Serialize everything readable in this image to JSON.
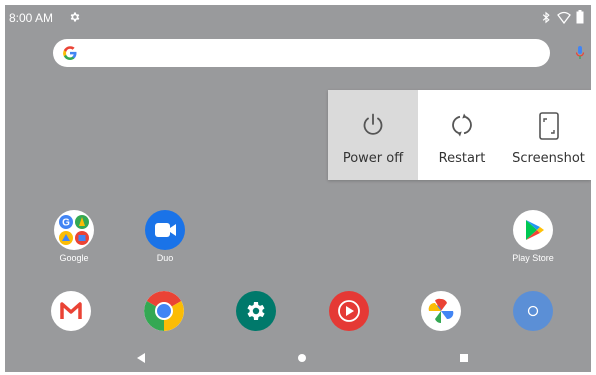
{
  "status_bar": {
    "time": "8:00 AM",
    "icons": [
      "settings-gear-icon",
      "bluetooth-icon",
      "wifi-icon",
      "battery-icon"
    ]
  },
  "search_bar": {
    "logo": "google-g-icon",
    "mic": "mic-icon"
  },
  "power_menu": {
    "items": [
      {
        "label": "Power off",
        "icon": "power-icon",
        "highlighted": true
      },
      {
        "label": "Restart",
        "icon": "restart-icon"
      },
      {
        "label": "Screenshot",
        "icon": "screenshot-icon"
      }
    ]
  },
  "home_apps": [
    {
      "label": "Google",
      "icon": "google-folder-icon"
    },
    {
      "label": "Duo",
      "icon": "duo-icon"
    },
    {
      "label": "Play Store",
      "icon": "play-store-icon"
    }
  ],
  "dock": [
    {
      "name": "gmail",
      "icon": "gmail-icon"
    },
    {
      "name": "chrome",
      "icon": "chrome-icon"
    },
    {
      "name": "settings",
      "icon": "settings-icon"
    },
    {
      "name": "youtube-music",
      "icon": "youtube-music-icon"
    },
    {
      "name": "photos",
      "icon": "photos-icon"
    },
    {
      "name": "app-drawer",
      "icon": "app-drawer-icon"
    }
  ],
  "nav_bar": {
    "icons": [
      "back-icon",
      "home-icon",
      "recents-icon"
    ]
  },
  "colors": {
    "wallpaper": "#999a9c",
    "menu_bg": "#ffffff",
    "menu_highlight": "#dadada",
    "duo_blue": "#1a73e8",
    "settings_teal": "#00796b",
    "youtube_red": "#e53935",
    "drawer_blue": "#5b8fd6"
  }
}
